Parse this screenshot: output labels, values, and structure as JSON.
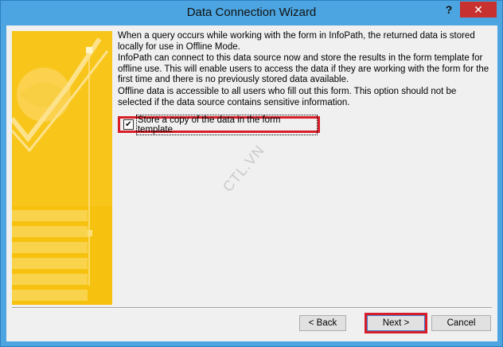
{
  "window": {
    "title": "Data Connection Wizard",
    "help_label": "?",
    "close_label": "✕"
  },
  "content": {
    "paragraph_1": "When a query occurs while working with the form in InfoPath, the returned data is stored locally for use in Offline Mode.",
    "paragraph_2": "InfoPath can connect to this data source now and store the results in the form template for offline use. This will enable users to access the data if they are working with the form for the first time and there is no previously stored data available.",
    "paragraph_3": "Offline data is accessible to all users who fill out this form. This option should not be selected if the data source contains sensitive information.",
    "checkbox_label": "Store a copy of the data in the form template",
    "checkbox_checked": true
  },
  "watermark": "CTL.VN",
  "buttons": {
    "back_label": "< Back",
    "next_label": "Next >",
    "cancel_label": "Cancel"
  },
  "colors": {
    "title_bar": "#4ca5e0",
    "close_button": "#c7312f",
    "highlight_box": "#d71e28",
    "art_panel": "#f6c20f"
  }
}
